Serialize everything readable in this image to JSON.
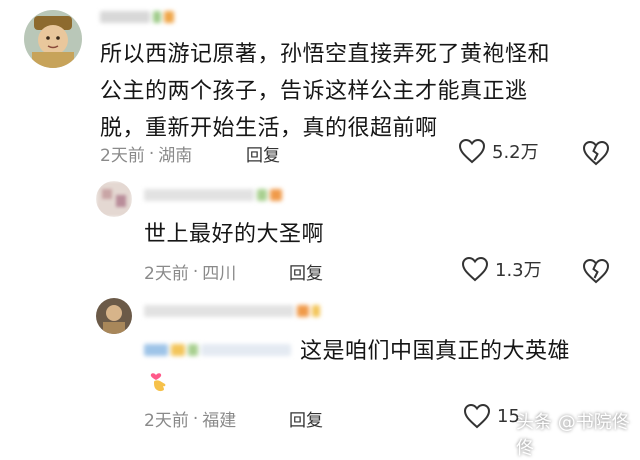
{
  "comments": [
    {
      "text_lines": [
        "所以西游记原著，孙悟空直接弄死了黄袍怪和",
        "公主的两个孩子，告诉这样公主才能真正逃",
        "脱，重新开始生活，真的很超前啊"
      ],
      "time": "2天前",
      "location": "湖南",
      "reply_label": "回复",
      "likes": "5.2万"
    },
    {
      "text_lines": [
        "世上最好的大圣啊"
      ],
      "time": "2天前",
      "location": "四川",
      "reply_label": "回复",
      "likes": "1.3万"
    },
    {
      "text_lines": [
        "这是咱们中国真正的大英雄"
      ],
      "time": "2天前",
      "location": "福建",
      "reply_label": "回复",
      "likes": "15"
    }
  ],
  "separator": "·",
  "watermark": "头条 @书院佟佟",
  "icons": {
    "like": "heart-outline-icon",
    "dislike": "broken-heart-icon",
    "emoji": "heart-hand-emoji"
  },
  "colors": {
    "meta_text": "#8a8a8a",
    "body_text": "#161616",
    "emoji": "#ff5a8a"
  }
}
